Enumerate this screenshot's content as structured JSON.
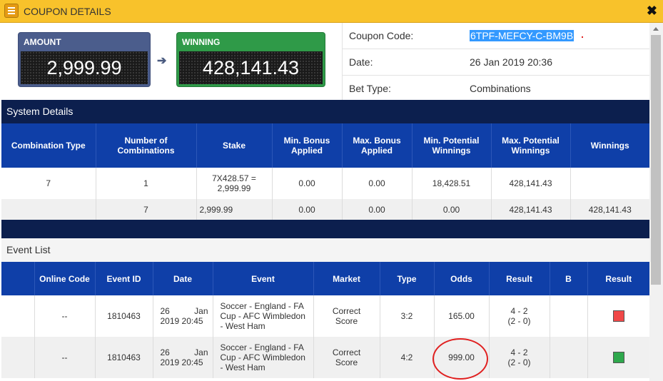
{
  "window": {
    "title": "COUPON DETAILS",
    "close_glyph": "✖",
    "title_icon": "list-icon"
  },
  "amount": {
    "label": "AMOUNT",
    "value": "2,999.99"
  },
  "winning": {
    "label": "WINNING",
    "value": "428,141.43"
  },
  "colors": {
    "titlebar": "#f8c22b",
    "amount_box": "#4b5d8c",
    "winning_box": "#2f9a48",
    "header_dark": "#0c1f4e",
    "header_blue": "#0f3fa8",
    "status_red": "#f04848",
    "status_green": "#2ea84c"
  },
  "coupon_info": [
    {
      "label": "Coupon Code:",
      "value": "6TPF-MEFCY-C-BM9B"
    },
    {
      "label": "Date:",
      "value": "26 Jan 2019 20:36"
    },
    {
      "label": "Bet Type:",
      "value": "Combinations"
    }
  ],
  "system_details": {
    "title": "System Details",
    "columns": [
      "Combination Type",
      "Number of Combinations",
      "Stake",
      "Min. Bonus Applied",
      "Max. Bonus Applied",
      "Min. Potential Winnings",
      "Max. Potential Winnings",
      "Winnings"
    ],
    "rows": [
      [
        "7",
        "1",
        "7X428.57 = 2,999.99",
        "0.00",
        "0.00",
        "18,428.51",
        "428,141.43",
        ""
      ],
      [
        "",
        "7",
        "2,999.99",
        "0.00",
        "0.00",
        "0.00",
        "428,141.43",
        "428,141.43"
      ]
    ]
  },
  "event_list": {
    "title": "Event List",
    "columns": [
      "",
      "Online Code",
      "Event ID",
      "Date",
      "Event",
      "Market",
      "Type",
      "Odds",
      "Result",
      "B",
      "Result"
    ],
    "rows": [
      {
        "online_code": "--",
        "event_id": "1810463",
        "date_day": "26",
        "date_month": "Jan",
        "date_rest": "2019 20:45",
        "event": "Soccer - England - FA Cup - AFC Wimbledon - West Ham",
        "market": "Correct Score",
        "type": "3:2",
        "odds": "165.00",
        "result_line1": "4 - 2",
        "result_line2": "(2 - 0)",
        "b": "",
        "status": "lost"
      },
      {
        "online_code": "--",
        "event_id": "1810463",
        "date_day": "26",
        "date_month": "Jan",
        "date_rest": "2019 20:45",
        "event": "Soccer - England - FA Cup - AFC Wimbledon - West Ham",
        "market": "Correct Score",
        "type": "4:2",
        "odds": "999.00",
        "result_line1": "4 - 2",
        "result_line2": "(2 - 0)",
        "b": "",
        "status": "won"
      }
    ]
  }
}
